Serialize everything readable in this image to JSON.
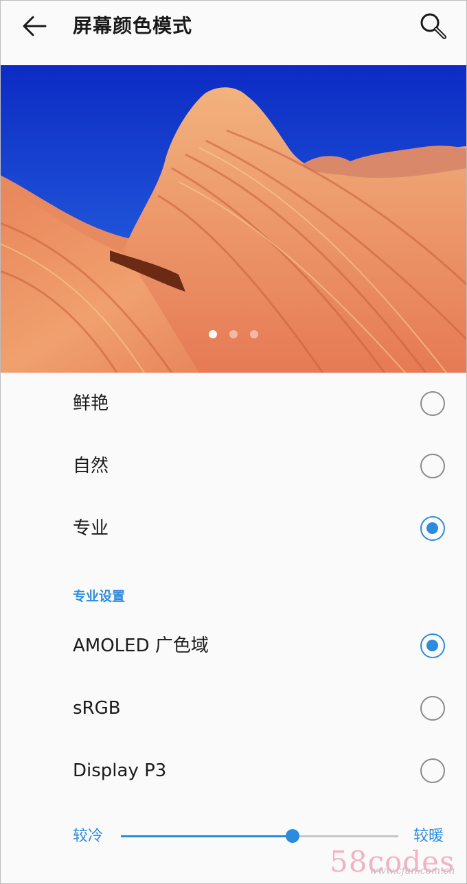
{
  "header": {
    "title": "屏幕颜色模式",
    "back_icon": "arrow-left-icon",
    "search_icon": "search-icon"
  },
  "hero": {
    "pages": 3,
    "active_page": 1
  },
  "modes": [
    {
      "label": "鲜艳",
      "checked": false
    },
    {
      "label": "自然",
      "checked": false
    },
    {
      "label": "专业",
      "checked": true
    }
  ],
  "pro_settings": {
    "title": "专业设置",
    "options": [
      {
        "label": "AMOLED 广色域",
        "checked": true
      },
      {
        "label": "sRGB",
        "checked": false
      },
      {
        "label": "Display P3",
        "checked": false
      }
    ]
  },
  "temperature": {
    "left_label": "较冷",
    "right_label": "较暖",
    "value": 0.62
  },
  "watermark": {
    "main": "58codes",
    "sub": "www.cfan.com.cn"
  },
  "colors": {
    "accent": "#2b8bde",
    "radio_off": "#8a8a8a",
    "background": "#fafafa"
  }
}
